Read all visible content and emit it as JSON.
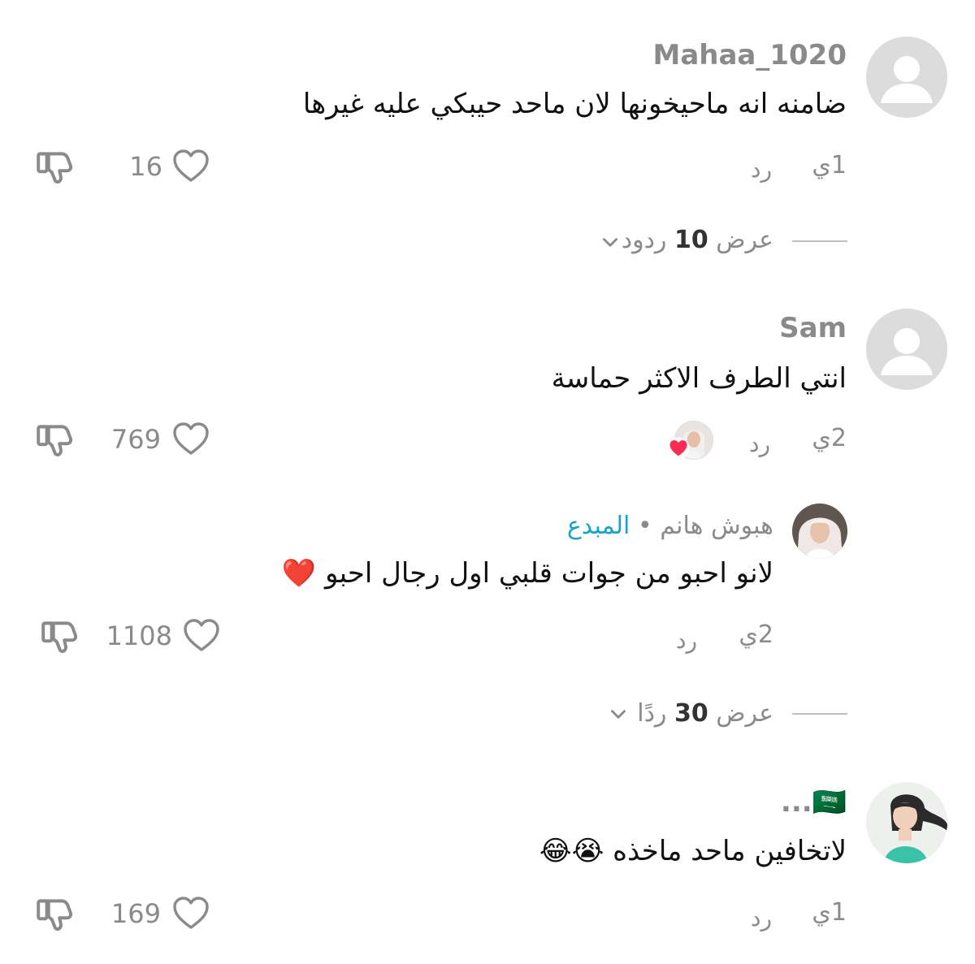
{
  "comments": [
    {
      "username": "Mahaa_1020",
      "text": "ضامنه انه ماحيخونها لان ماحد حيبكي عليه غيرها",
      "time": "1ي",
      "reply": "رد",
      "likes": "16",
      "view_replies": {
        "prefix": "عرض",
        "count": "10",
        "suffix": "ردود"
      }
    },
    {
      "username": "Sam",
      "text": "انتي الطرف الاكثر حماسة",
      "time": "2ي",
      "reply": "رد",
      "likes": "769"
    },
    {
      "username": "هبوش هانم",
      "dot": "•",
      "badge": "المبدع",
      "text": "لانو احبو من جوات قلبي اول رجال احبو ❤️",
      "time": "2ي",
      "reply": "رد",
      "likes": "1108",
      "view_replies": {
        "prefix": "عرض",
        "count": "30",
        "suffix": "ردًا"
      }
    },
    {
      "username": "...🇸🇦",
      "text": "لاتخافين ماحد ماخذه 😭😂",
      "time": "1ي",
      "reply": "رد",
      "likes": "169"
    }
  ],
  "icons": {
    "like": "heart-outline-icon",
    "dislike": "thumbs-down-icon",
    "chevron": "chevron-down-icon",
    "creator_liked": "red-heart-badge"
  },
  "colors": {
    "text_primary": "#111111",
    "text_secondary": "#8a8a8a",
    "creator_badge": "#1aa3c7",
    "liked_heart": "#fe2c55"
  }
}
